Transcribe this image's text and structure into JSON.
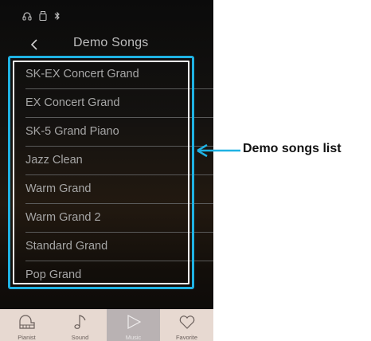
{
  "status_bar": {
    "icons": [
      "headphones-icon",
      "usb-drive-icon",
      "bluetooth-icon"
    ]
  },
  "header": {
    "title": "Demo Songs",
    "back_icon": "chevron-left-icon"
  },
  "demo_songs": [
    {
      "label": "SK-EX Concert Grand"
    },
    {
      "label": "EX Concert Grand"
    },
    {
      "label": "SK-5 Grand Piano"
    },
    {
      "label": "Jazz Clean"
    },
    {
      "label": "Warm Grand"
    },
    {
      "label": "Warm Grand 2"
    },
    {
      "label": "Standard Grand"
    },
    {
      "label": "Pop Grand"
    }
  ],
  "annotation": {
    "label": "Demo songs list",
    "color": "#1fb2e3"
  },
  "tabs": [
    {
      "label": "Pianist",
      "icon": "piano-icon",
      "active": false
    },
    {
      "label": "Sound",
      "icon": "music-note-icon",
      "active": false
    },
    {
      "label": "Music",
      "icon": "play-icon",
      "active": true
    },
    {
      "label": "Favorite",
      "icon": "heart-icon",
      "active": false
    }
  ]
}
